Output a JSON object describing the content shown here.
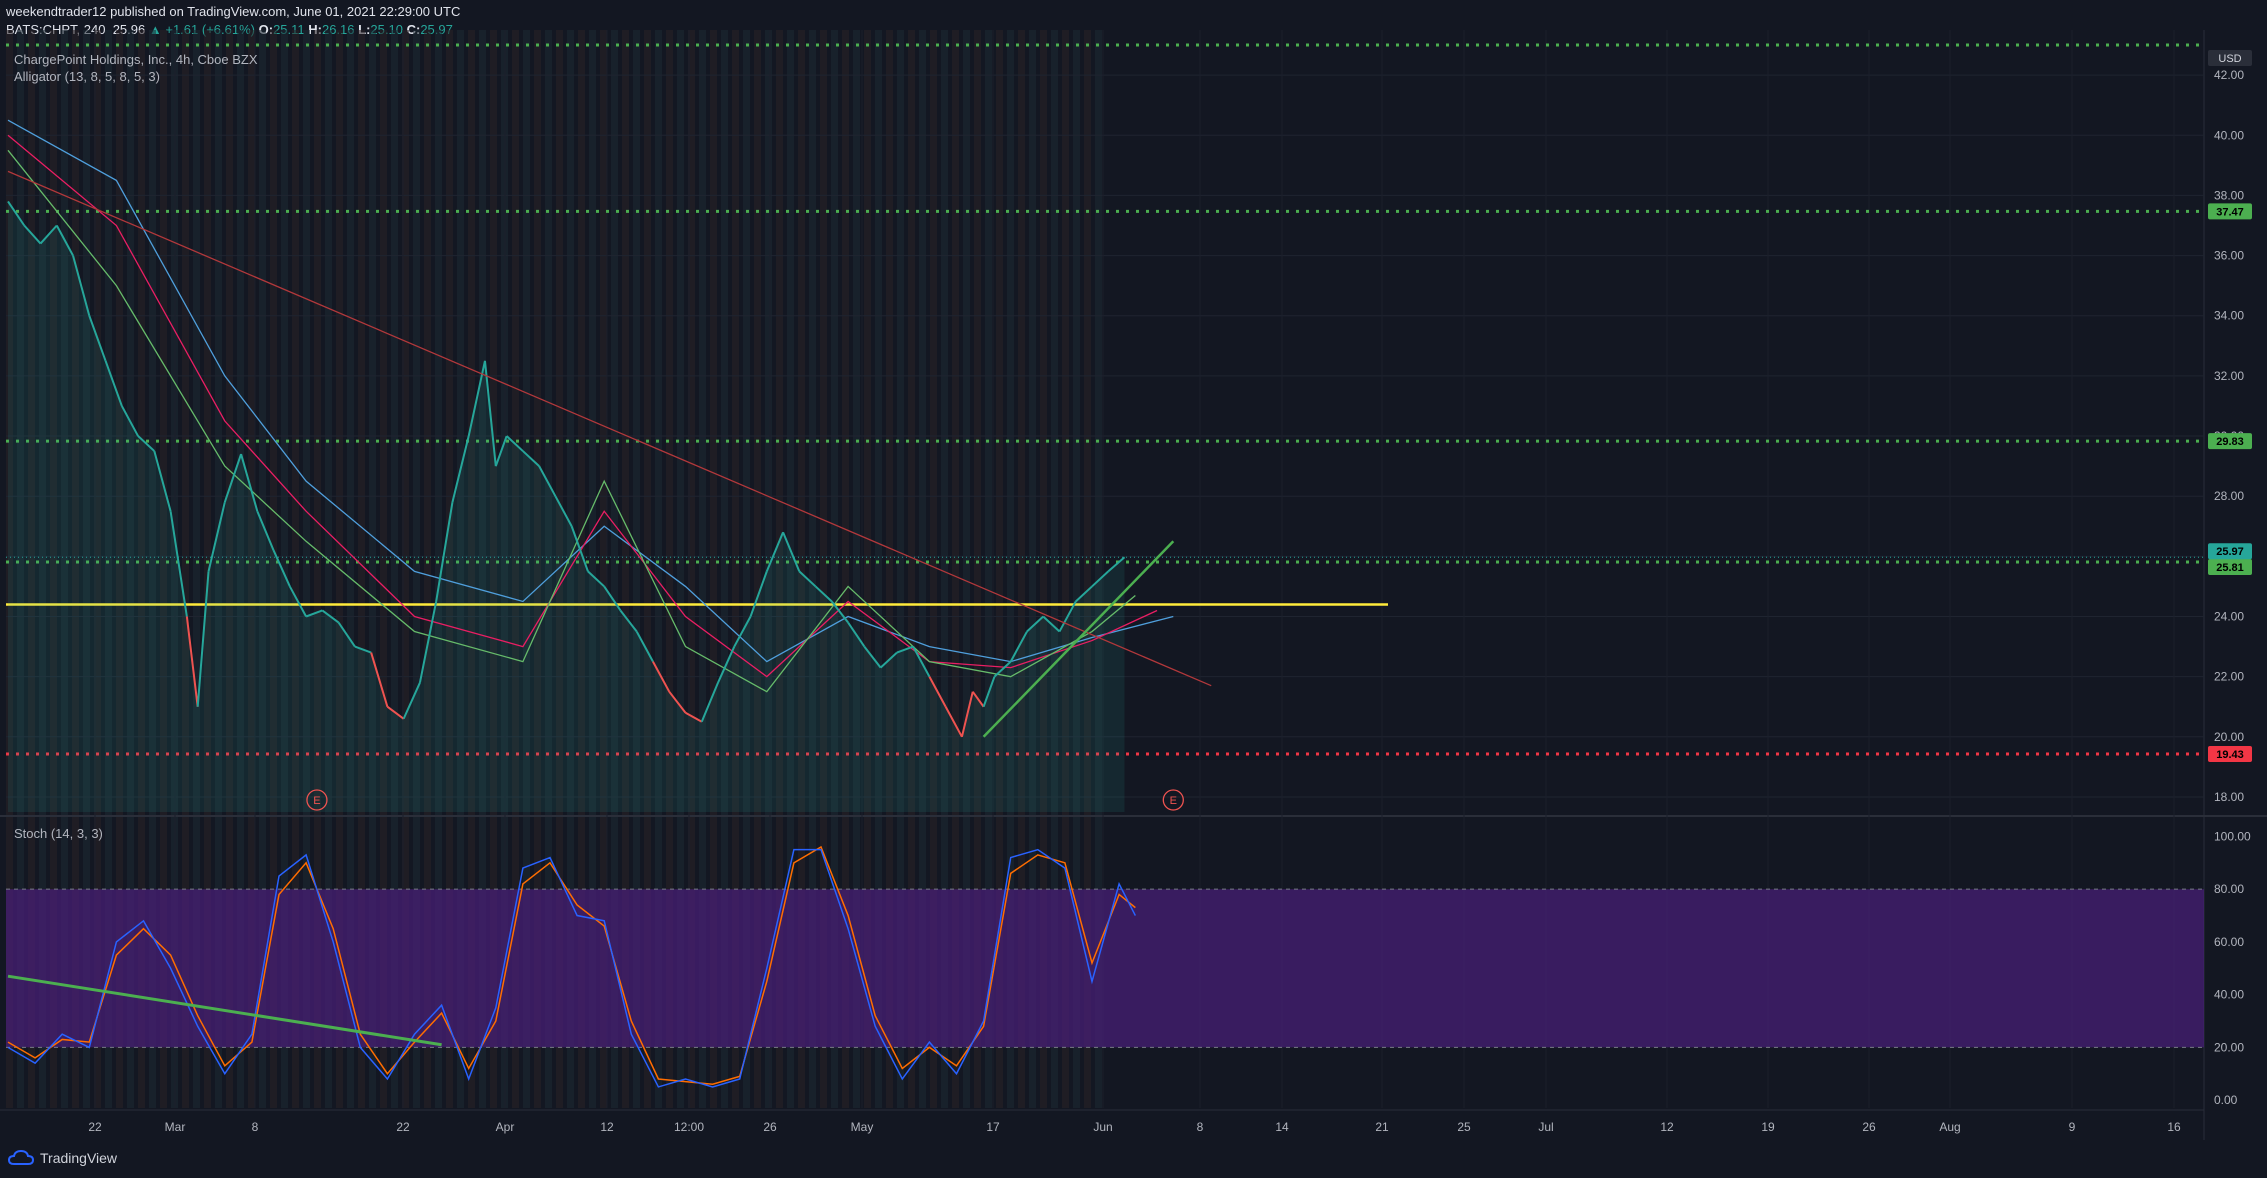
{
  "header": {
    "publisher_line": "weekendtrader12 published on TradingView.com, June 01, 2021 22:29:00 UTC",
    "symbol": "BATS:CHPT, 240",
    "last": "25.96",
    "change": "+1.61 (+6.61%)",
    "ohlc": {
      "o": "25.11",
      "h": "26.16",
      "l": "25.10",
      "c": "25.97"
    }
  },
  "legend": {
    "instrument": "ChargePoint Holdings, Inc., 4h, Cboe BZX",
    "alligator": "Alligator (13, 8, 5, 8, 5, 3)",
    "stoch": "Stoch (14, 3, 3)"
  },
  "footer": {
    "brand": "TradingView"
  },
  "colors": {
    "background": "#131722",
    "price_up": "#26a69a",
    "price_down": "#ef5350",
    "level_green": "#4caf50",
    "level_red": "#f23645",
    "support_yellow": "#ffeb3b",
    "stoch_k": "#2962ff",
    "stoch_d": "#ff6d00",
    "stoch_band": "#4a1f7a"
  },
  "chart_data": [
    {
      "type": "line",
      "name": "price",
      "currency": "USD",
      "ylim": [
        17.5,
        43.5
      ],
      "y_ticks": [
        18,
        20,
        22,
        24,
        26,
        28,
        30,
        32,
        34,
        36,
        38,
        40,
        42
      ],
      "x_ticks": [
        "22",
        "Mar",
        "8",
        "22",
        "Apr",
        "12",
        "12:00",
        "26",
        "May",
        "17",
        "Jun",
        "8",
        "14",
        "21",
        "25",
        "Jul",
        "12",
        "19",
        "26",
        "Aug",
        "9",
        "16"
      ],
      "close": [
        [
          0,
          37.8
        ],
        [
          3,
          37.0
        ],
        [
          6,
          36.4
        ],
        [
          9,
          37.0
        ],
        [
          12,
          36.0
        ],
        [
          15,
          34.0
        ],
        [
          18,
          32.5
        ],
        [
          21,
          31.0
        ],
        [
          24,
          30.0
        ],
        [
          27,
          29.5
        ],
        [
          30,
          27.5
        ],
        [
          33,
          24.0
        ],
        [
          35,
          21.0
        ],
        [
          37,
          25.5
        ],
        [
          40,
          27.8
        ],
        [
          43,
          29.4
        ],
        [
          46,
          27.5
        ],
        [
          49,
          26.2
        ],
        [
          52,
          25.0
        ],
        [
          55,
          24.0
        ],
        [
          58,
          24.2
        ],
        [
          61,
          23.8
        ],
        [
          64,
          23.0
        ],
        [
          67,
          22.8
        ],
        [
          70,
          21.0
        ],
        [
          73,
          20.6
        ],
        [
          76,
          21.8
        ],
        [
          79,
          24.5
        ],
        [
          82,
          27.8
        ],
        [
          85,
          30.0
        ],
        [
          88,
          32.5
        ],
        [
          90,
          29.0
        ],
        [
          92,
          30.0
        ],
        [
          95,
          29.5
        ],
        [
          98,
          29.0
        ],
        [
          101,
          28.0
        ],
        [
          104,
          27.0
        ],
        [
          107,
          25.5
        ],
        [
          110,
          25.0
        ],
        [
          113,
          24.2
        ],
        [
          116,
          23.5
        ],
        [
          119,
          22.5
        ],
        [
          122,
          21.5
        ],
        [
          125,
          20.8
        ],
        [
          128,
          20.5
        ],
        [
          131,
          21.8
        ],
        [
          134,
          23.0
        ],
        [
          137,
          24.0
        ],
        [
          140,
          25.5
        ],
        [
          143,
          26.8
        ],
        [
          146,
          25.5
        ],
        [
          149,
          25.0
        ],
        [
          152,
          24.5
        ],
        [
          155,
          23.8
        ],
        [
          158,
          23.0
        ],
        [
          161,
          22.3
        ],
        [
          164,
          22.8
        ],
        [
          167,
          23.0
        ],
        [
          170,
          22.0
        ],
        [
          173,
          21.0
        ],
        [
          176,
          20.0
        ],
        [
          178,
          21.5
        ],
        [
          180,
          21.0
        ],
        [
          182,
          22.0
        ],
        [
          185,
          22.5
        ],
        [
          188,
          23.5
        ],
        [
          191,
          24.0
        ],
        [
          194,
          23.5
        ],
        [
          197,
          24.5
        ],
        [
          200,
          25.0
        ],
        [
          203,
          25.5
        ],
        [
          206,
          25.97
        ]
      ],
      "alligator": {
        "jaw": [
          [
            0,
            40.5
          ],
          [
            20,
            38.5
          ],
          [
            40,
            32.0
          ],
          [
            55,
            28.5
          ],
          [
            75,
            25.5
          ],
          [
            95,
            24.5
          ],
          [
            110,
            27.0
          ],
          [
            125,
            25.0
          ],
          [
            140,
            22.5
          ],
          [
            155,
            24.0
          ],
          [
            170,
            23.0
          ],
          [
            185,
            22.5
          ],
          [
            200,
            23.3
          ],
          [
            215,
            24.0
          ]
        ],
        "teeth": [
          [
            0,
            40.0
          ],
          [
            20,
            37.0
          ],
          [
            40,
            30.5
          ],
          [
            55,
            27.5
          ],
          [
            75,
            24.0
          ],
          [
            95,
            23.0
          ],
          [
            110,
            27.5
          ],
          [
            125,
            24.0
          ],
          [
            140,
            22.0
          ],
          [
            155,
            24.5
          ],
          [
            170,
            22.5
          ],
          [
            185,
            22.3
          ],
          [
            200,
            23.2
          ],
          [
            212,
            24.2
          ]
        ],
        "lips": [
          [
            0,
            39.5
          ],
          [
            20,
            35.0
          ],
          [
            40,
            29.0
          ],
          [
            55,
            26.5
          ],
          [
            75,
            23.5
          ],
          [
            95,
            22.5
          ],
          [
            110,
            28.5
          ],
          [
            125,
            23.0
          ],
          [
            140,
            21.5
          ],
          [
            155,
            25.0
          ],
          [
            170,
            22.5
          ],
          [
            185,
            22.0
          ],
          [
            200,
            23.5
          ],
          [
            208,
            24.7
          ]
        ]
      },
      "horizontal_levels": [
        {
          "price": 43.0,
          "style": "dotted",
          "color": "green"
        },
        {
          "price": 37.47,
          "style": "dotted",
          "color": "green",
          "label": "37.47"
        },
        {
          "price": 29.83,
          "style": "dotted",
          "color": "green",
          "label": "29.83"
        },
        {
          "price": 25.81,
          "style": "dotted",
          "color": "green",
          "label": "25.81"
        },
        {
          "price": 24.4,
          "style": "solid",
          "color": "yellow"
        },
        {
          "price": 19.43,
          "style": "dotted",
          "color": "red",
          "label": "19.43"
        }
      ],
      "last_price_label": "25.97",
      "trendlines": [
        {
          "from": [
            0,
            38.8
          ],
          "to": [
            222,
            21.7
          ],
          "color": "red"
        },
        {
          "from": [
            180,
            20.0
          ],
          "to": [
            215,
            26.5
          ],
          "color": "green"
        }
      ],
      "earnings_markers": [
        {
          "x": 57,
          "label": "E"
        },
        {
          "x": 215,
          "label": "E"
        }
      ]
    },
    {
      "type": "line",
      "name": "stochastic",
      "ylim": [
        -3,
        107
      ],
      "y_ticks": [
        0,
        20,
        40,
        60,
        80,
        100
      ],
      "band": [
        20,
        80
      ],
      "k": [
        [
          0,
          20
        ],
        [
          5,
          14
        ],
        [
          10,
          25
        ],
        [
          15,
          20
        ],
        [
          20,
          60
        ],
        [
          25,
          68
        ],
        [
          30,
          50
        ],
        [
          35,
          28
        ],
        [
          40,
          10
        ],
        [
          45,
          25
        ],
        [
          50,
          85
        ],
        [
          55,
          93
        ],
        [
          60,
          60
        ],
        [
          65,
          20
        ],
        [
          70,
          8
        ],
        [
          75,
          25
        ],
        [
          80,
          36
        ],
        [
          85,
          8
        ],
        [
          90,
          35
        ],
        [
          95,
          88
        ],
        [
          100,
          92
        ],
        [
          105,
          70
        ],
        [
          110,
          68
        ],
        [
          115,
          25
        ],
        [
          120,
          5
        ],
        [
          125,
          8
        ],
        [
          130,
          5
        ],
        [
          135,
          8
        ],
        [
          140,
          50
        ],
        [
          145,
          95
        ],
        [
          150,
          95
        ],
        [
          155,
          65
        ],
        [
          160,
          28
        ],
        [
          165,
          8
        ],
        [
          170,
          22
        ],
        [
          175,
          10
        ],
        [
          180,
          30
        ],
        [
          185,
          92
        ],
        [
          190,
          95
        ],
        [
          195,
          88
        ],
        [
          200,
          45
        ],
        [
          205,
          82
        ],
        [
          208,
          70
        ]
      ],
      "d": [
        [
          0,
          22
        ],
        [
          5,
          16
        ],
        [
          10,
          23
        ],
        [
          15,
          22
        ],
        [
          20,
          55
        ],
        [
          25,
          65
        ],
        [
          30,
          55
        ],
        [
          35,
          32
        ],
        [
          40,
          13
        ],
        [
          45,
          22
        ],
        [
          50,
          78
        ],
        [
          55,
          90
        ],
        [
          60,
          65
        ],
        [
          65,
          25
        ],
        [
          70,
          10
        ],
        [
          75,
          22
        ],
        [
          80,
          33
        ],
        [
          85,
          12
        ],
        [
          90,
          30
        ],
        [
          95,
          82
        ],
        [
          100,
          90
        ],
        [
          105,
          74
        ],
        [
          110,
          66
        ],
        [
          115,
          30
        ],
        [
          120,
          8
        ],
        [
          125,
          7
        ],
        [
          130,
          6
        ],
        [
          135,
          9
        ],
        [
          140,
          45
        ],
        [
          145,
          90
        ],
        [
          150,
          96
        ],
        [
          155,
          70
        ],
        [
          160,
          32
        ],
        [
          165,
          12
        ],
        [
          170,
          20
        ],
        [
          175,
          13
        ],
        [
          180,
          28
        ],
        [
          185,
          86
        ],
        [
          190,
          93
        ],
        [
          195,
          90
        ],
        [
          200,
          52
        ],
        [
          205,
          78
        ],
        [
          208,
          73
        ]
      ],
      "trendline": {
        "from": [
          0,
          47
        ],
        "to": [
          80,
          21
        ],
        "color": "green"
      }
    }
  ]
}
